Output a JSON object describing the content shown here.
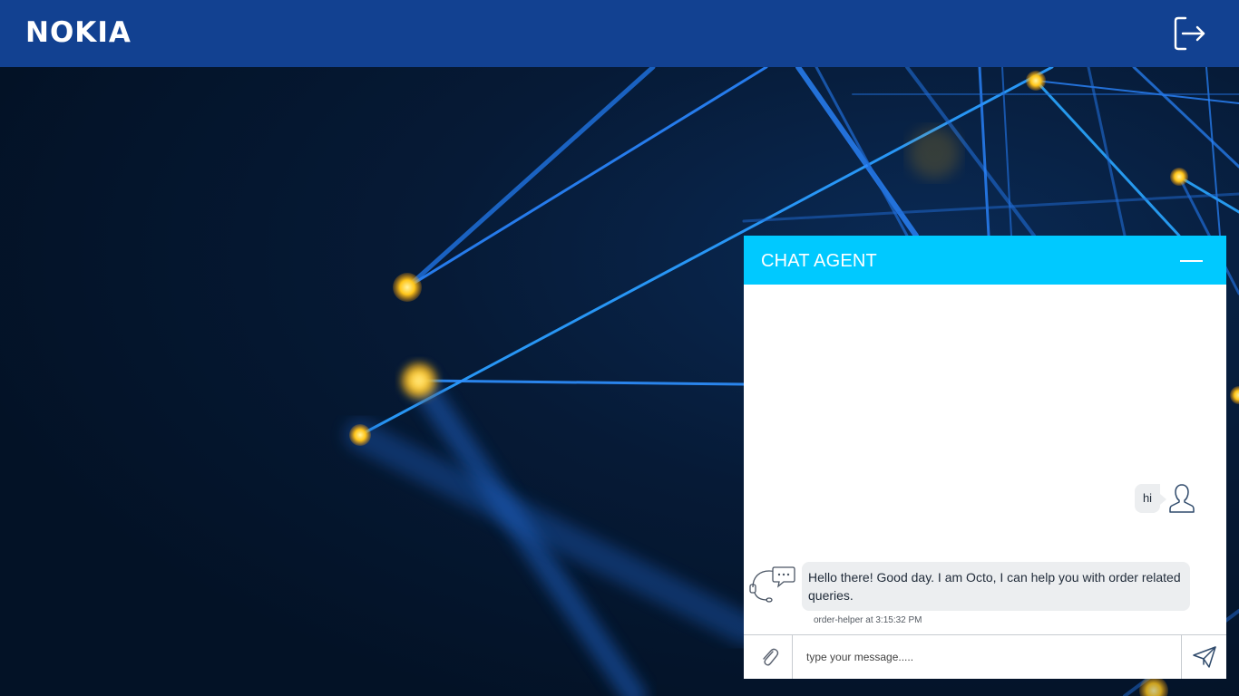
{
  "header": {
    "logo_text": "NOKIA",
    "logout_icon": "logout-icon",
    "background_color": "#124191"
  },
  "chat": {
    "title": "CHAT AGENT",
    "header_color": "#00c9ff",
    "minimize_icon": "minimize-icon",
    "messages": [
      {
        "sender": "user",
        "text": "hi",
        "icon": "user-icon"
      },
      {
        "sender": "agent",
        "text": "Hello there! Good day. I am Octo, I can help you with order related queries.",
        "meta": "order-helper at 3:15:32 PM",
        "icon": "agent-headset-icon"
      }
    ],
    "input": {
      "placeholder": "type your message.....",
      "value": "",
      "attach_icon": "paperclip-icon",
      "send_icon": "send-icon"
    }
  }
}
